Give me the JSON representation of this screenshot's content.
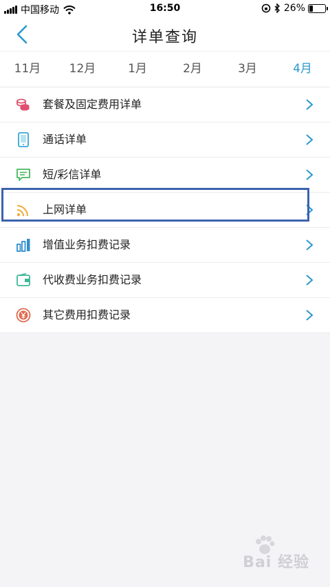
{
  "status_bar": {
    "carrier": "中国移动",
    "time": "16:50",
    "battery": "26%",
    "battery_level": 0.26
  },
  "nav": {
    "title": "详单查询"
  },
  "tabs": [
    {
      "label": "11月"
    },
    {
      "label": "12月"
    },
    {
      "label": "1月"
    },
    {
      "label": "2月"
    },
    {
      "label": "3月"
    },
    {
      "label": "4月",
      "active": true
    }
  ],
  "menu": [
    {
      "label": "套餐及固定费用详单",
      "icon": "coins-icon",
      "color": "#e0506e"
    },
    {
      "label": "通话详单",
      "icon": "phone-icon",
      "color": "#34a8d8"
    },
    {
      "label": "短/彩信详单",
      "icon": "message-icon",
      "color": "#48b760"
    },
    {
      "label": "上网详单",
      "icon": "rss-icon",
      "color": "#f2a93b"
    },
    {
      "label": "增值业务扣费记录",
      "icon": "bar-chart-icon",
      "color": "#2f8fce"
    },
    {
      "label": "代收费业务扣费记录",
      "icon": "wallet-icon",
      "color": "#3cb79a"
    },
    {
      "label": "其它费用扣费记录",
      "icon": "yuan-coin-icon",
      "color": "#e06a4c"
    }
  ],
  "watermark": "Bai 经验"
}
